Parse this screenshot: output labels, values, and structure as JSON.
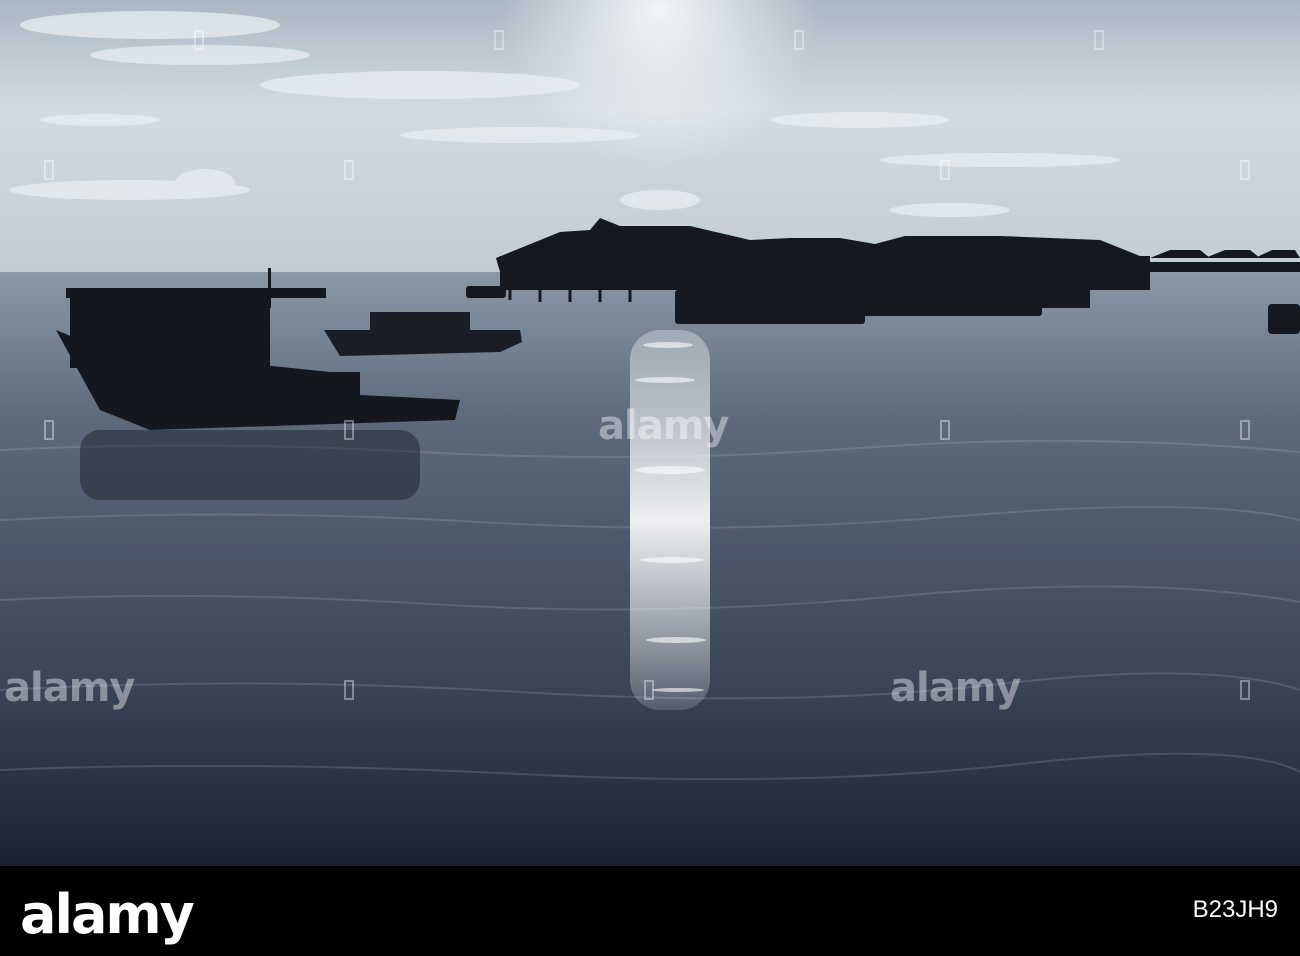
{
  "photo": {
    "subject": "Water village resort on stilts at sunset, with boats silhouetted on calm sea",
    "watermark_text": "alamy",
    "image_id": "B23JH9"
  },
  "colors": {
    "sky_top": "#c8d2da",
    "sky_bottom": "#b8c4cc",
    "sea_top": "#6e7c8c",
    "sea_bottom": "#222a3a",
    "silhouette": "#15181f",
    "sun_glare": "#f4f7fb",
    "bar": "#000000"
  }
}
